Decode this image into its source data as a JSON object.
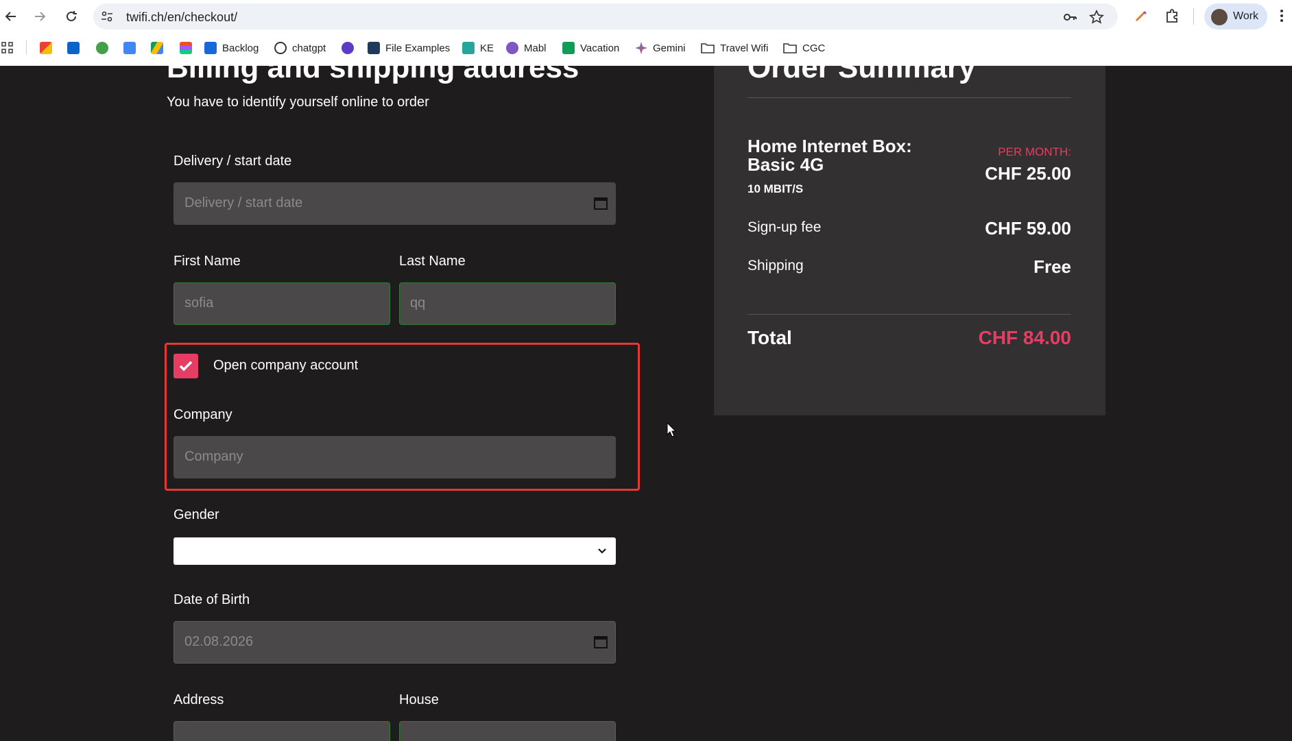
{
  "browser": {
    "url": "twifi.ch/en/checkout/",
    "profile_label": "Work",
    "bookmarks": [
      {
        "label": ""
      },
      {
        "label": ""
      },
      {
        "label": ""
      },
      {
        "label": ""
      },
      {
        "label": ""
      },
      {
        "label": ""
      },
      {
        "label": "Backlog"
      },
      {
        "label": "chatgpt"
      },
      {
        "label": ""
      },
      {
        "label": "File Examples"
      },
      {
        "label": "KE"
      },
      {
        "label": "Mabl"
      },
      {
        "label": "Vacation"
      },
      {
        "label": "Gemini"
      },
      {
        "label": "Travel Wifi"
      },
      {
        "label": "CGC"
      }
    ]
  },
  "form": {
    "heading": "Billing and shipping address",
    "subheading": "You have to identify yourself online to order",
    "delivery_label": "Delivery / start date",
    "delivery_placeholder": "Delivery / start date",
    "first_name_label": "First Name",
    "first_name_value": "sofia",
    "last_name_label": "Last Name",
    "last_name_value": "qq",
    "company_account_label": "Open company account",
    "company_account_checked": true,
    "company_label": "Company",
    "company_placeholder": "Company",
    "gender_label": "Gender",
    "gender_value": "",
    "dob_label": "Date of Birth",
    "dob_value": "02.08.2026",
    "address_label": "Address",
    "house_label": "House"
  },
  "summary": {
    "title": "Order Summary",
    "product_name": "Home Internet Box: Basic 4G",
    "product_speed": "10 MBIT/S",
    "per_month_label": "PER MONTH:",
    "monthly_price": "CHF 25.00",
    "signup_label": "Sign-up fee",
    "signup_price": "CHF 59.00",
    "shipping_label": "Shipping",
    "shipping_price": "Free",
    "total_label": "Total",
    "total_price": "CHF 84.00"
  },
  "colors": {
    "accent": "#e53d63",
    "page_bg": "#1e1c1d",
    "field_bg": "#4a4849",
    "highlight_border": "#e53935",
    "valid_border": "#2e7d32"
  }
}
